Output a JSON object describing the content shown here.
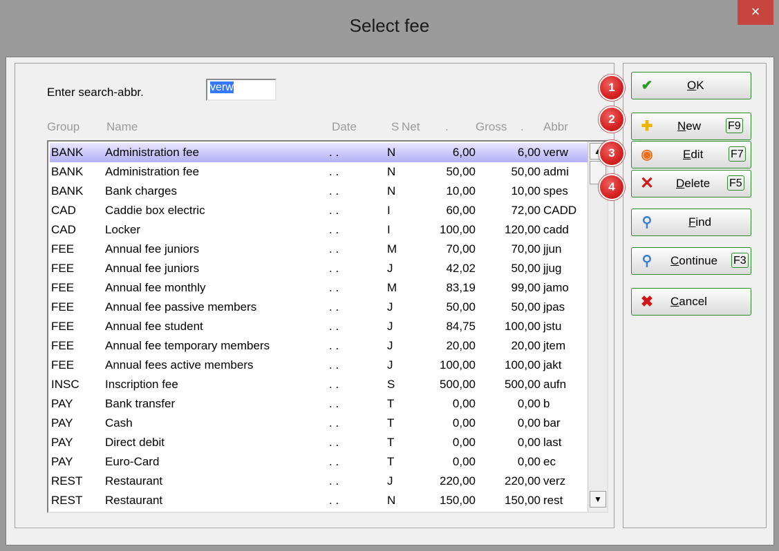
{
  "window": {
    "title": "Select fee",
    "close_glyph": "×"
  },
  "search": {
    "label": "Enter search-abbr.",
    "value": "verw"
  },
  "columns": {
    "group": "Group",
    "name": "Name",
    "date": "Date",
    "s": "S",
    "net": "Net",
    "gross": "Gross",
    "abbr": "Abbr",
    "dot": "."
  },
  "rows": [
    {
      "group": "BANK",
      "name": "Administration fee",
      "date": ". .",
      "s": "N",
      "net": "6,00",
      "gross": "6,00",
      "abbr": "verw",
      "selected": true
    },
    {
      "group": "BANK",
      "name": "Administration fee",
      "date": ". .",
      "s": "N",
      "net": "50,00",
      "gross": "50,00",
      "abbr": "admi"
    },
    {
      "group": "BANK",
      "name": "Bank charges",
      "date": ". .",
      "s": "N",
      "net": "10,00",
      "gross": "10,00",
      "abbr": "spes"
    },
    {
      "group": "CAD",
      "name": "Caddie box electric",
      "date": ". .",
      "s": "I",
      "net": "60,00",
      "gross": "72,00",
      "abbr": "CADD"
    },
    {
      "group": "CAD",
      "name": "Locker",
      "date": ". .",
      "s": "I",
      "net": "100,00",
      "gross": "120,00",
      "abbr": "cadd"
    },
    {
      "group": "FEE",
      "name": "Annual fee juniors",
      "date": ". .",
      "s": "M",
      "net": "70,00",
      "gross": "70,00",
      "abbr": "jjun"
    },
    {
      "group": "FEE",
      "name": "Annual fee juniors",
      "date": ". .",
      "s": "J",
      "net": "42,02",
      "gross": "50,00",
      "abbr": "jjug"
    },
    {
      "group": "FEE",
      "name": "Annual fee monthly",
      "date": ". .",
      "s": "M",
      "net": "83,19",
      "gross": "99,00",
      "abbr": "jamo"
    },
    {
      "group": "FEE",
      "name": "Annual fee passive members",
      "date": ". .",
      "s": "J",
      "net": "50,00",
      "gross": "50,00",
      "abbr": "jpas"
    },
    {
      "group": "FEE",
      "name": "Annual fee student",
      "date": ". .",
      "s": "J",
      "net": "84,75",
      "gross": "100,00",
      "abbr": "jstu"
    },
    {
      "group": "FEE",
      "name": "Annual fee temporary members",
      "date": ". .",
      "s": "J",
      "net": "20,00",
      "gross": "20,00",
      "abbr": "jtem"
    },
    {
      "group": "FEE",
      "name": "Annual fees active members",
      "date": ". .",
      "s": "J",
      "net": "100,00",
      "gross": "100,00",
      "abbr": "jakt"
    },
    {
      "group": "INSC",
      "name": "Inscription fee",
      "date": ". .",
      "s": "S",
      "net": "500,00",
      "gross": "500,00",
      "abbr": "aufn"
    },
    {
      "group": "PAY",
      "name": "Bank transfer",
      "date": ". .",
      "s": "T",
      "net": "0,00",
      "gross": "0,00",
      "abbr": "b"
    },
    {
      "group": "PAY",
      "name": "Cash",
      "date": ". .",
      "s": "T",
      "net": "0,00",
      "gross": "0,00",
      "abbr": "bar"
    },
    {
      "group": "PAY",
      "name": "Direct debit",
      "date": ". .",
      "s": "T",
      "net": "0,00",
      "gross": "0,00",
      "abbr": "last"
    },
    {
      "group": "PAY",
      "name": "Euro-Card",
      "date": ". .",
      "s": "T",
      "net": "0,00",
      "gross": "0,00",
      "abbr": "ec"
    },
    {
      "group": "REST",
      "name": "Restaurant",
      "date": ". .",
      "s": "J",
      "net": "220,00",
      "gross": "220,00",
      "abbr": "verz"
    },
    {
      "group": "REST",
      "name": "Restaurant",
      "date": ". .",
      "s": "N",
      "net": "150,00",
      "gross": "150,00",
      "abbr": "rest"
    }
  ],
  "buttons": {
    "ok": {
      "mnemonic": "O",
      "rest": "K",
      "icon": "checkmark-icon"
    },
    "new": {
      "mnemonic": "N",
      "rest": "ew",
      "key": "F9",
      "icon": "plus-icon"
    },
    "edit": {
      "mnemonic": "E",
      "rest": "dit",
      "key": "F7",
      "icon": "ring-icon"
    },
    "delete": {
      "mnemonic": "D",
      "rest": "elete",
      "key": "F5",
      "icon": "x-icon"
    },
    "find": {
      "mnemonic": "F",
      "rest": "ind",
      "icon": "magnifier-icon"
    },
    "continue": {
      "mnemonic": "C",
      "rest": "ontinue",
      "key": "F3",
      "icon": "magnifier-arrow-icon"
    },
    "cancel": {
      "mnemonic": "C",
      "rest": "ancel",
      "icon": "cancel-x-icon"
    }
  },
  "badges": [
    "1",
    "2",
    "3",
    "4"
  ],
  "colors": {
    "accent_green": "#2a8a2a",
    "badge_red": "#d42222",
    "selection": "#b4b0f8",
    "close_red": "#c7453f"
  },
  "scroll": {
    "up_glyph": "▲",
    "down_glyph": "▼"
  }
}
